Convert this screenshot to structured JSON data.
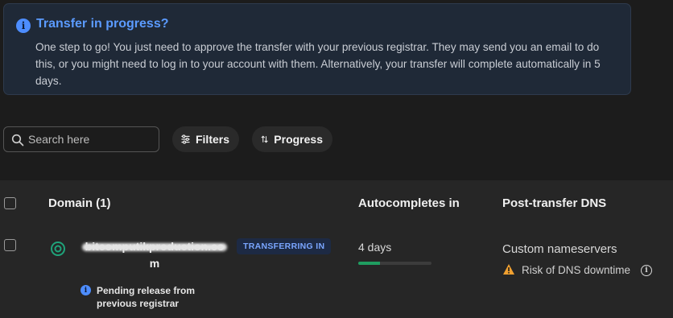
{
  "banner": {
    "title": "Transfer in progress?",
    "body": "One step to go! You just need to approve the transfer with your previous registrar. They may send you an email to do this, or you might need to log in to your account with them. Alternatively, your transfer will complete automatically in 5 days.",
    "icon": "info-icon",
    "accent": "#5b9bff"
  },
  "toolbar": {
    "search_placeholder": "Search here",
    "filters_label": "Filters",
    "progress_label": "Progress"
  },
  "table": {
    "headers": {
      "domain": "Domain (1)",
      "autocompletes": "Autocompletes in",
      "dns": "Post-transfer DNS"
    },
    "rows": [
      {
        "domain_line1": "bitcomputikproduction.co",
        "domain_line2": "m",
        "status_badge": "TRANSFERRING IN",
        "pending_note": "Pending release from previous registrar",
        "autocompletes": "4 days",
        "progress_fraction": 0.3,
        "dns_value": "Custom nameservers",
        "dns_warning": "Risk of DNS downtime"
      }
    ]
  },
  "colors": {
    "progress": "#1f9d60",
    "warning": "#f0a030",
    "badge_text": "#7aa6ff"
  }
}
